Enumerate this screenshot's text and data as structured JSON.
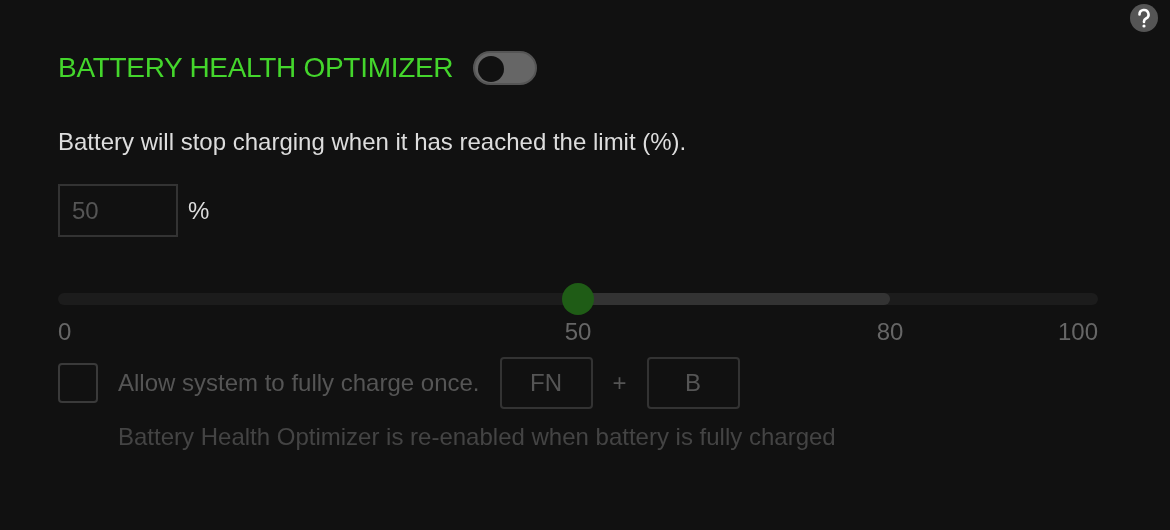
{
  "title": "BATTERY HEALTH OPTIMIZER",
  "toggle": {
    "on": false
  },
  "description": "Battery will stop charging when it has reached the limit (%).",
  "limit_input": {
    "value": "50",
    "unit": "%",
    "disabled": true
  },
  "slider": {
    "level": 0.5,
    "range_end": {
      "level": 0.8
    },
    "ticks": [
      "0",
      "50",
      "80",
      "100"
    ]
  },
  "full_charge": {
    "label": "Allow system to fully charge once.",
    "checked": false,
    "disabled": true,
    "keys": [
      "FN",
      "B"
    ],
    "key_separator": "+",
    "note": "Battery Health Optimizer is re-enabled when battery is fully charged"
  }
}
